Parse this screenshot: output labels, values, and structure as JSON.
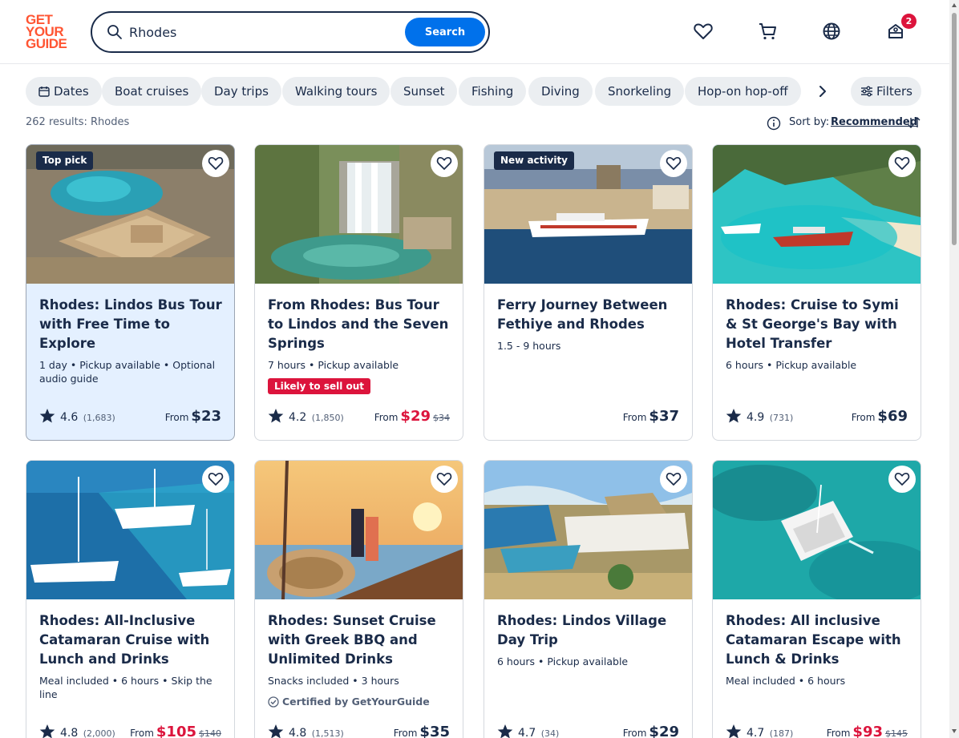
{
  "header": {
    "logo_lines": [
      "GET",
      "YOUR",
      "GUIDE"
    ],
    "search_value": "Rhodes",
    "search_button": "Search",
    "cart_badge": "2"
  },
  "filters": {
    "chips": [
      "Dates",
      "Boat cruises",
      "Day trips",
      "Walking tours",
      "Sunset",
      "Fishing",
      "Diving",
      "Snorkeling",
      "Hop-on hop-off"
    ],
    "filters_label": "Filters"
  },
  "results": {
    "count_text": "262 results: Rhodes",
    "sort_label": "Sort by:",
    "sort_value": "Recommended"
  },
  "cards": [
    {
      "tag": "Top pick",
      "title": "Rhodes: Lindos Bus Tour with Free Time to Explore",
      "meta": "1 day • Pickup available • Optional audio guide",
      "rating": "4.6",
      "reviews": "(1,683)",
      "from": "From",
      "price": "$23",
      "old_price": ""
    },
    {
      "tag": "",
      "title": "From Rhodes: Bus Tour to Lindos and the Seven Springs",
      "meta": "7 hours • Pickup available",
      "badge": "Likely to sell out",
      "rating": "4.2",
      "reviews": "(1,850)",
      "from": "From",
      "price": "$29",
      "old_price": "$34"
    },
    {
      "tag": "New activity",
      "title": "Ferry Journey Between Fethiye and Rhodes",
      "meta": "1.5 - 9 hours",
      "rating": "",
      "reviews": "",
      "from": "From",
      "price": "$37",
      "old_price": ""
    },
    {
      "tag": "",
      "title": "Rhodes: Cruise to Symi & St George's Bay with Hotel Transfer",
      "meta": "6 hours • Pickup available",
      "rating": "4.9",
      "reviews": "(731)",
      "from": "From",
      "price": "$69",
      "old_price": ""
    },
    {
      "tag": "",
      "title": "Rhodes: All-Inclusive Catamaran Cruise with Lunch and Drinks",
      "meta": "Meal included • 6 hours • Skip the line",
      "rating": "4.8",
      "reviews": "(2,000)",
      "from": "From",
      "price": "$105",
      "old_price": "$140"
    },
    {
      "tag": "",
      "title": "Rhodes: Sunset Cruise with Greek BBQ and Unlimited Drinks",
      "meta": "Snacks included • 3 hours",
      "certified": "Certified by GetYourGuide",
      "rating": "4.8",
      "reviews": "(1,513)",
      "from": "From",
      "price": "$35",
      "old_price": ""
    },
    {
      "tag": "",
      "title": "Rhodes: Lindos Village Day Trip",
      "meta": "6 hours • Pickup available",
      "rating": "4.7",
      "reviews": "(34)",
      "from": "From",
      "price": "$29",
      "old_price": ""
    },
    {
      "tag": "",
      "title": "Rhodes: All inclusive Catamaran Escape with Lunch & Drinks",
      "meta": "Meal included • 6 hours",
      "rating": "4.7",
      "reviews": "(187)",
      "from": "From",
      "price": "$93",
      "old_price": "$145"
    }
  ]
}
